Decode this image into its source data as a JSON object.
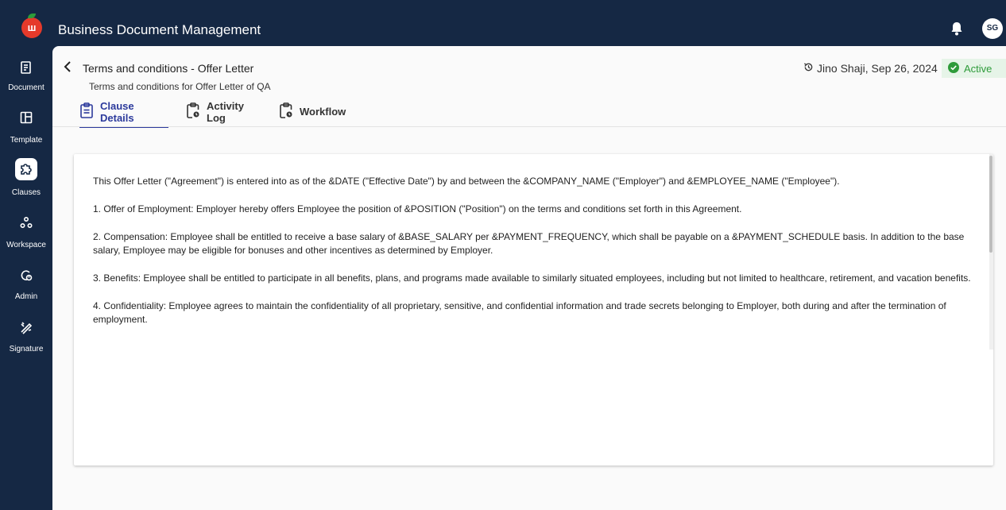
{
  "app": {
    "title": "Business Document Management",
    "logo_letter": "ш",
    "user_initials": "SG"
  },
  "sidebar": {
    "items": [
      {
        "label": "Document",
        "icon": "document-icon"
      },
      {
        "label": "Template",
        "icon": "template-icon"
      },
      {
        "label": "Clauses",
        "icon": "clauses-icon",
        "active": true
      },
      {
        "label": "Workspace",
        "icon": "workspace-icon"
      },
      {
        "label": "Admin",
        "icon": "admin-icon"
      },
      {
        "label": "Signature",
        "icon": "signature-icon"
      }
    ]
  },
  "header": {
    "title": "Terms and conditions - Offer Letter",
    "subtitle": "Terms and conditions for Offer Letter of QA",
    "author_date": "Jino Shaji, Sep 26, 2024",
    "status": "Active"
  },
  "tabs": [
    {
      "label": "Clause Details",
      "active": true
    },
    {
      "label": "Activity Log"
    },
    {
      "label": "Workflow"
    }
  ],
  "content": {
    "paragraphs": [
      "This Offer Letter (\"Agreement\") is entered into as of the &DATE (\"Effective Date\") by and between the &COMPANY_NAME (\"Employer\") and &EMPLOYEE_NAME (\"Employee\").",
      "1. Offer of Employment: Employer hereby offers Employee the position of &POSITION (\"Position\") on the terms and conditions set forth in this Agreement.",
      "2. Compensation: Employee shall be entitled to receive a base salary of &BASE_SALARY per &PAYMENT_FREQUENCY, which shall be payable on a &PAYMENT_SCHEDULE basis. In addition to the base salary, Employee may be eligible for bonuses and other incentives as determined by Employer.",
      "3. Benefits: Employee shall be entitled to participate in all benefits, plans, and programs made available to similarly situated employees, including but not limited to healthcare, retirement, and vacation benefits.",
      "4. Confidentiality: Employee agrees to maintain the confidentiality of all proprietary, sensitive, and confidential information and trade secrets belonging to Employer, both during and after the termination of employment."
    ]
  },
  "colors": {
    "brand_dark": "#152844",
    "accent": "#2c3a9c",
    "status_green": "#2e9b3a",
    "logo_red": "#e53a2b"
  }
}
